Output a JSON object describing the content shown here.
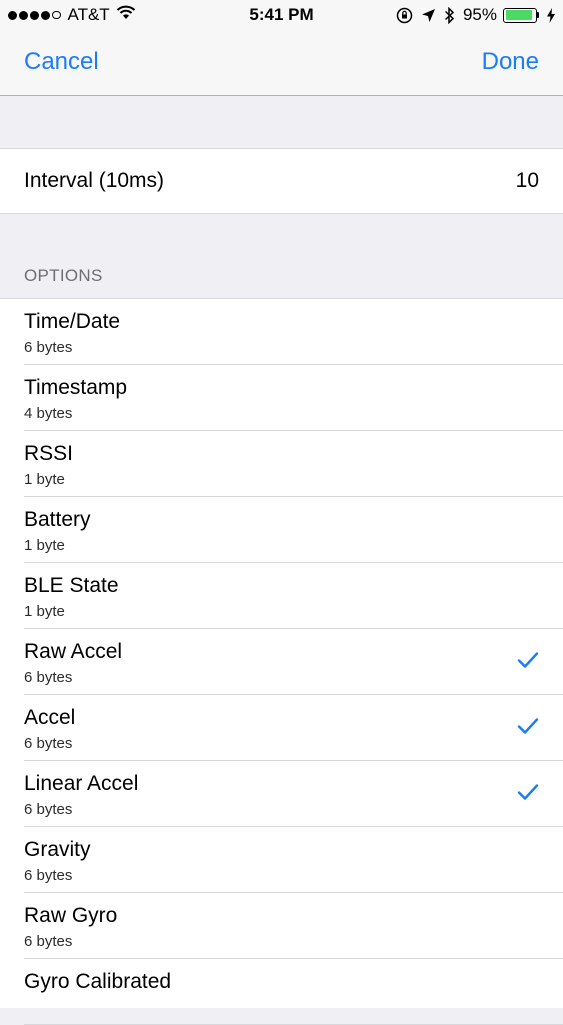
{
  "status_bar": {
    "carrier": "AT&T",
    "time": "5:41 PM",
    "battery_percent": "95%",
    "battery_level": 0.95,
    "signal_bars_filled": 4,
    "signal_bars_total": 5,
    "icons": [
      "wifi-icon",
      "orientation-lock-icon",
      "location-icon",
      "bluetooth-icon",
      "charging-icon"
    ]
  },
  "nav": {
    "cancel_label": "Cancel",
    "done_label": "Done"
  },
  "interval": {
    "label": "Interval (10ms)",
    "value": "10"
  },
  "options": {
    "header": "OPTIONS",
    "items": [
      {
        "title": "Time/Date",
        "size": "6 bytes",
        "checked": false
      },
      {
        "title": "Timestamp",
        "size": "4 bytes",
        "checked": false
      },
      {
        "title": "RSSI",
        "size": "1 byte",
        "checked": false
      },
      {
        "title": "Battery",
        "size": "1 byte",
        "checked": false
      },
      {
        "title": "BLE State",
        "size": "1 byte",
        "checked": false
      },
      {
        "title": "Raw Accel",
        "size": "6 bytes",
        "checked": true
      },
      {
        "title": "Accel",
        "size": "6 bytes",
        "checked": true
      },
      {
        "title": "Linear Accel",
        "size": "6 bytes",
        "checked": true
      },
      {
        "title": "Gravity",
        "size": "6 bytes",
        "checked": false
      },
      {
        "title": "Raw Gyro",
        "size": "6 bytes",
        "checked": false
      },
      {
        "title": "Gyro Calibrated",
        "size": "",
        "checked": false
      }
    ]
  },
  "colors": {
    "accent": "#1a7cf6",
    "battery": "#4cd964",
    "background": "#efeff4"
  }
}
